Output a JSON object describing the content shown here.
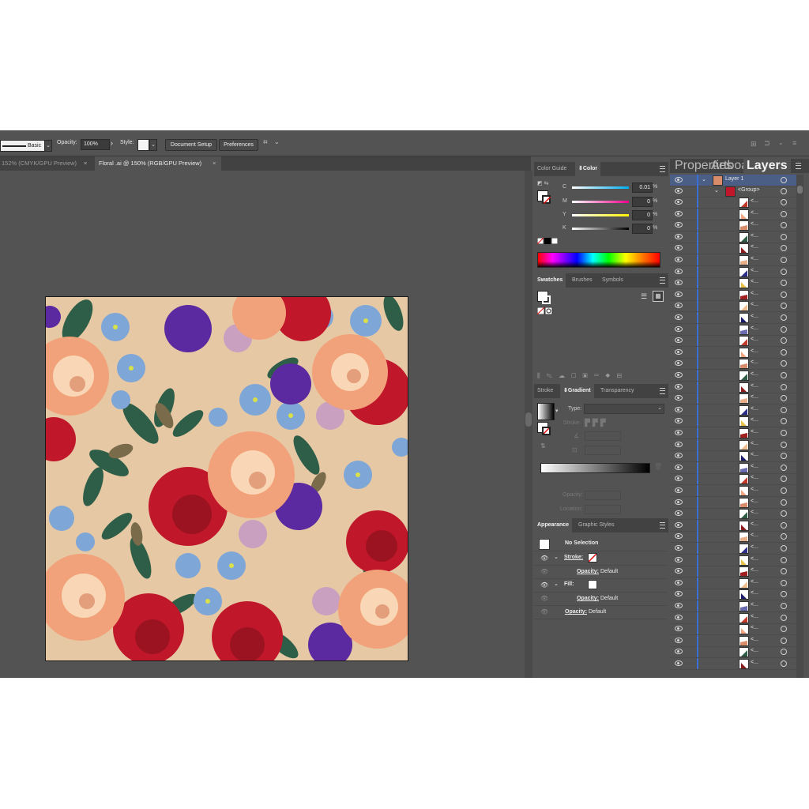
{
  "control_bar": {
    "stroke_profile": "Basic",
    "opacity_label": "Opacity:",
    "opacity_value": "100%",
    "style_label": "Style:",
    "document_setup": "Document Setup",
    "preferences": "Preferences"
  },
  "document_tabs": [
    {
      "label": "152% (CMYK/GPU Preview)",
      "active": false
    },
    {
      "label": "Floral .ai @ 150% (RGB/GPU Preview)",
      "active": true
    }
  ],
  "color_panel": {
    "tabs": [
      "Color Guide",
      "Color"
    ],
    "active_tab": "Color",
    "channels": [
      {
        "label": "C",
        "value": "0.01",
        "unit": "%",
        "color": "#00aeef"
      },
      {
        "label": "M",
        "value": "0",
        "unit": "%",
        "color": "#ec008c"
      },
      {
        "label": "Y",
        "value": "0",
        "unit": "%",
        "color": "#fff200"
      },
      {
        "label": "K",
        "value": "0",
        "unit": "%",
        "color": "#000000"
      }
    ]
  },
  "swatches_panel": {
    "tabs": [
      "Swatches",
      "Brushes",
      "Symbols"
    ],
    "active_tab": "Swatches"
  },
  "gradient_panel": {
    "tabs": [
      "Stroke",
      "Gradient",
      "Transparency"
    ],
    "active_tab": "Gradient",
    "type_label": "Type:",
    "stroke_label": "Stroke:",
    "opacity_label": "Opacity:",
    "location_label": "Location:"
  },
  "appearance_panel": {
    "tabs": [
      "Appearance",
      "Graphic Styles"
    ],
    "active_tab": "Appearance",
    "selection": "No Selection",
    "rows": [
      {
        "label": "Stroke:",
        "kind": "stroke"
      },
      {
        "label": "Opacity:",
        "value": "Default",
        "indent": true
      },
      {
        "label": "Fill:",
        "kind": "fill"
      },
      {
        "label": "Opacity:",
        "value": "Default",
        "indent": true
      },
      {
        "label": "Opacity:",
        "value": "Default",
        "indent": false
      }
    ]
  },
  "layers_panel": {
    "tabs": [
      "Properties",
      "Artboards",
      "Layers"
    ],
    "active_tab": "Layers",
    "layer_name": "Layer 1",
    "group_name": "<Group>",
    "path_label": "<...",
    "path_thumb_colors": [
      "#c0392b",
      "#f4a582",
      "#d98c6a",
      "#2d5e45",
      "#8b1a1a",
      "#e8b08a",
      "#2d2d8a",
      "#e8c44a",
      "#a02020",
      "#f2c090",
      "#1a1a6a",
      "#6a6ab0"
    ]
  },
  "artwork": {
    "background": "#e6c8a5",
    "rose_red": "#c0182a",
    "rose_peach": "#f2a27a",
    "flower_purple": "#5b2aa0",
    "flower_blue": "#7ea6d6",
    "leaf_green": "#2f5e48"
  }
}
